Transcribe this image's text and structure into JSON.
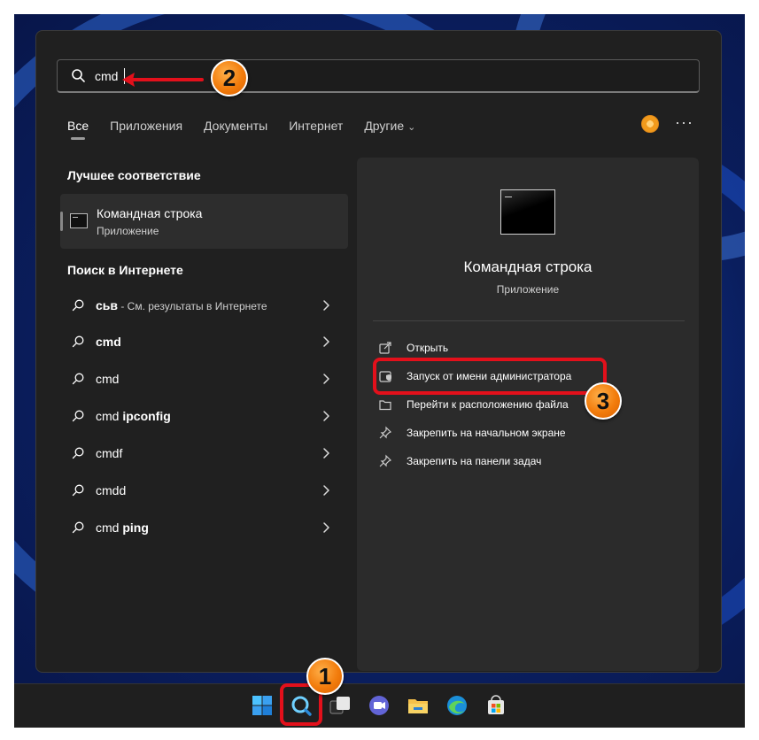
{
  "search": {
    "value": "cmd"
  },
  "tabs": [
    {
      "label": "Все",
      "active": true
    },
    {
      "label": "Приложения"
    },
    {
      "label": "Документы"
    },
    {
      "label": "Интернет"
    },
    {
      "label": "Другие",
      "has_dropdown": true
    }
  ],
  "best_match": {
    "heading": "Лучшее соответствие",
    "name": "Командная строка",
    "type": "Приложение"
  },
  "web_search": {
    "heading": "Поиск в Интернете",
    "items": [
      {
        "bold": "сьв",
        "rest": "",
        "sub": " - См. результаты в Интернете"
      },
      {
        "bold": "cmd",
        "rest": "",
        "sub": ""
      },
      {
        "bold": "",
        "rest": "cmd",
        "sub": ""
      },
      {
        "bold": "ipconfig",
        "rest": "cmd ",
        "sub": ""
      },
      {
        "bold": "",
        "rest": "cmdf",
        "sub": ""
      },
      {
        "bold": "",
        "rest": "cmdd",
        "sub": ""
      },
      {
        "bold": "ping",
        "rest": "cmd ",
        "sub": ""
      }
    ]
  },
  "preview": {
    "title": "Командная строка",
    "subtitle": "Приложение",
    "actions": [
      {
        "label": "Открыть",
        "icon": "open-icon"
      },
      {
        "label": "Запуск от имени администратора",
        "icon": "shield-icon"
      },
      {
        "label": "Перейти к расположению файла",
        "icon": "folder-icon"
      },
      {
        "label": "Закрепить на начальном экране",
        "icon": "pin-icon"
      },
      {
        "label": "Закрепить на панели задач",
        "icon": "pin-icon"
      }
    ]
  },
  "taskbar": {
    "icons": [
      "start-icon",
      "search-icon",
      "task-view-icon",
      "teams-icon",
      "file-explorer-icon",
      "edge-icon",
      "store-icon"
    ]
  },
  "annotations": {
    "steps": [
      "1",
      "2",
      "3"
    ],
    "color": "#e3101b"
  },
  "more_label": "···"
}
